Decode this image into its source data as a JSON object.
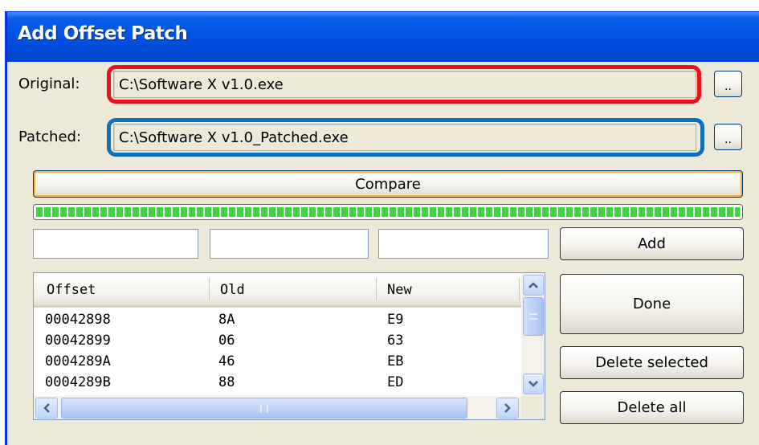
{
  "window": {
    "title": "Add Offset Patch"
  },
  "original": {
    "label": "Original:",
    "value": "C:\\Software X v1.0.exe",
    "browse_label": ".."
  },
  "patched": {
    "label": "Patched:",
    "value": "C:\\Software X v1.0_Patched.exe",
    "browse_label": ".."
  },
  "compare": {
    "label": "Compare"
  },
  "progress": {
    "value": 1.0
  },
  "entry": {
    "offset_value": "",
    "old_value": "",
    "new_value": ""
  },
  "buttons": {
    "add": "Add",
    "done": "Done",
    "delete_selected": "Delete selected",
    "delete_all": "Delete all"
  },
  "table": {
    "columns": [
      "Offset",
      "Old",
      "New"
    ],
    "rows": [
      [
        "00042898",
        "8A",
        "E9"
      ],
      [
        "00042899",
        "06",
        "63"
      ],
      [
        "0004289A",
        "46",
        "EB"
      ],
      [
        "0004289B",
        "88",
        "ED"
      ]
    ]
  },
  "highlights": {
    "original_color": "#e8131a",
    "patched_color": "#0f6fbf"
  },
  "colors": {
    "titlebar": "#0054e3",
    "dialog_bg": "#ece9d8",
    "progress": "#3ed43e"
  }
}
